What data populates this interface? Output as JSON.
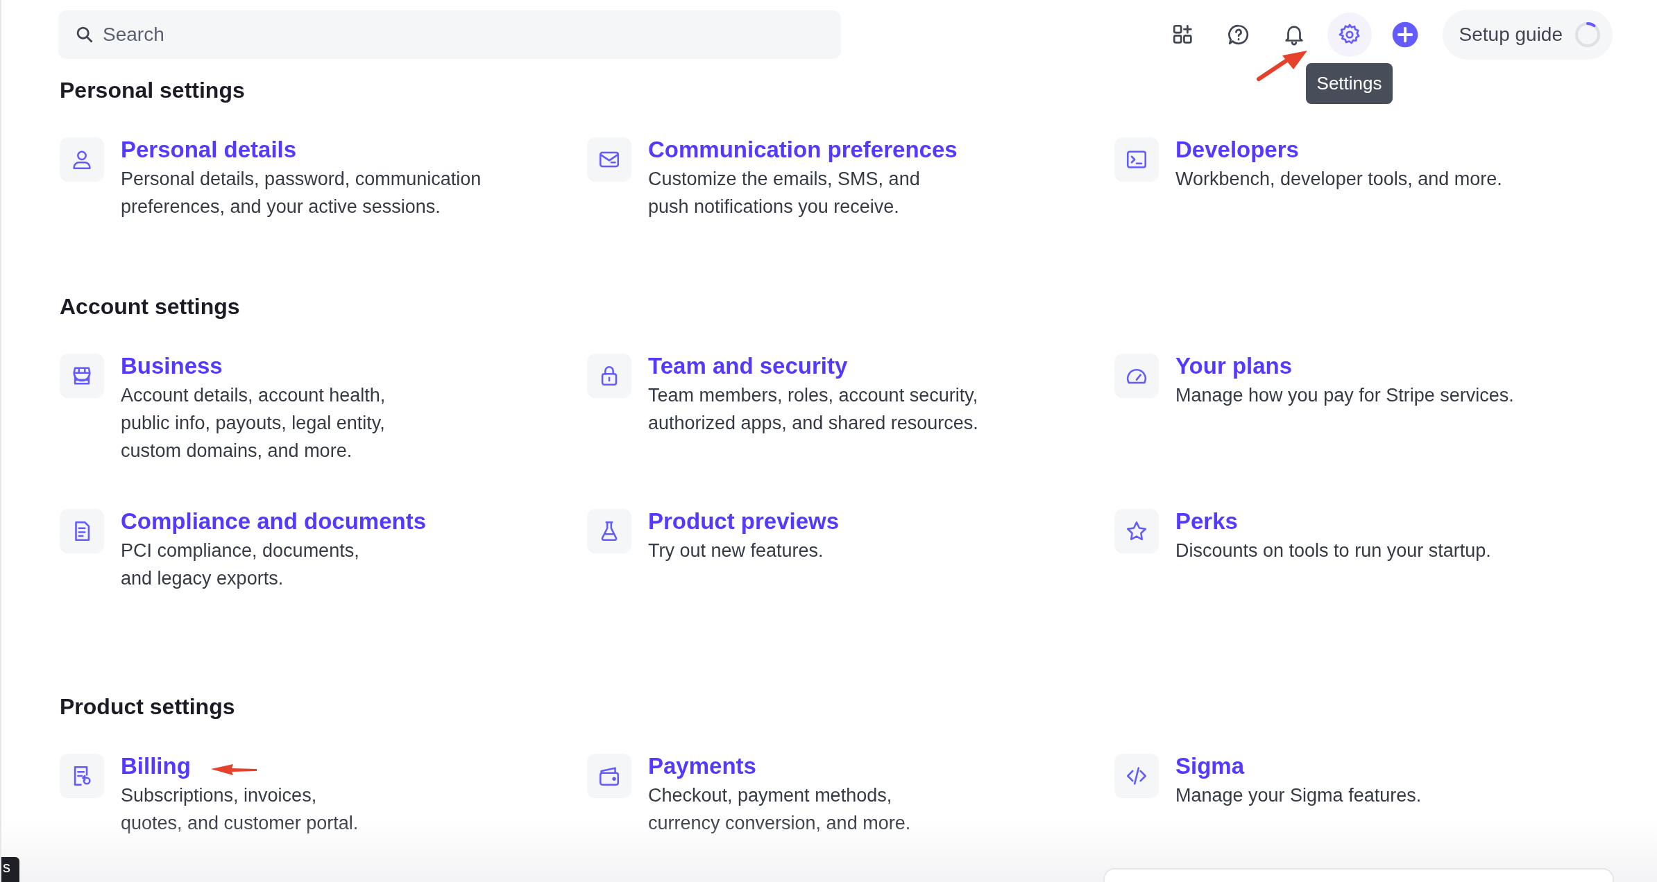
{
  "search": {
    "placeholder": "Search"
  },
  "toolbar": {
    "icons": [
      {
        "kind": "apps",
        "selected": false
      },
      {
        "kind": "help",
        "selected": false
      },
      {
        "kind": "bell",
        "selected": false
      },
      {
        "kind": "gear",
        "selected": true
      },
      {
        "kind": "plus",
        "selected": false
      }
    ],
    "tooltip": "Settings",
    "setup_guide": {
      "label": "Setup guide",
      "level": 0.1
    }
  },
  "sections": [
    {
      "title": "Personal settings",
      "items": [
        {
          "title": "Personal details",
          "description": "Personal details, password, communication\npreferences, and your active sessions."
        },
        {
          "title": "Communication preferences",
          "description": "Customize the emails, SMS, and\npush notifications you receive."
        },
        {
          "title": "Developers",
          "description": "Workbench, developer tools, and more."
        }
      ]
    },
    {
      "title": "Account settings",
      "items": [
        {
          "title": "Business",
          "description": "Account details, account health,\npublic info, payouts, legal entity,\ncustom domains, and more."
        },
        {
          "title": "Team and security",
          "description": "Team members, roles, account security,\nauthorized apps, and shared resources."
        },
        {
          "title": "Your plans",
          "description": "Manage how you pay for Stripe services."
        },
        {
          "title": "Compliance and documents",
          "description": "PCI compliance, documents,\nand legacy exports."
        },
        {
          "title": "Product previews",
          "description": "Try out new features."
        },
        {
          "title": "Perks",
          "description": "Discounts on tools to run your startup."
        }
      ]
    },
    {
      "title": "Product settings",
      "items": [
        {
          "title": "Billing",
          "description": "Subscriptions, invoices,\nquotes, and customer portal."
        },
        {
          "title": "Payments",
          "description": "Checkout, payment methods,\ncurrency conversion, and more."
        },
        {
          "title": "Sigma",
          "description": "Manage your Sigma features."
        }
      ]
    }
  ],
  "corner_tab": "s"
}
